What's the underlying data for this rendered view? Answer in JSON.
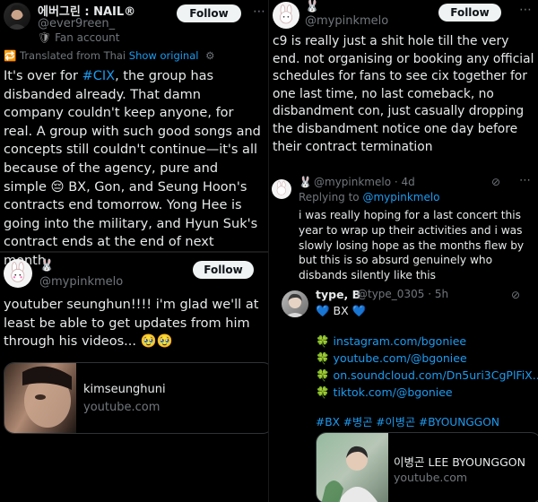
{
  "left": {
    "post1": {
      "display_name": "에버그린 : NAIL®",
      "handle": "@ever9reen_",
      "account_label": "Fan account",
      "follow_label": "Follow",
      "translated_label": "Translated from Thai",
      "show_original_label": "Show original",
      "text_before_tag": "It's over for ",
      "hashtag": "#CIX",
      "text_after_tag": ", the group has disbanded already. That damn company couldn't keep anyone, for real. A group with such good songs and concepts still couldn't continue—it's all because of the agency, pure and simple 😔 BX, Gon, and Seung Hoon's contracts end tomorrow. Yong Hee is going into the military, and Hyun Suk's contract ends at the end of next month."
    },
    "post2": {
      "display_name": "🐰",
      "handle": "@mypinkmelo",
      "follow_label": "Follow",
      "text": "youtuber seunghun!!!! i'm glad we'll at least be able to get updates from him through his videos... 🥹🥹",
      "card_title": "kimseunghuni",
      "card_domain": "youtube.com"
    }
  },
  "right": {
    "post1": {
      "display_name": "🐰",
      "handle": "@mypinkmelo",
      "follow_label": "Follow",
      "text": "c9 is really just a shit hole till the very end. not organising or booking any official schedules for fans to see cix together for one last time, no last comeback, no disbandment con, just casually dropping the disbandment notice one day before their contract termination"
    },
    "reply1": {
      "display_name": "🐰",
      "handle": "@mypinkmelo",
      "time": "· 4d",
      "replying_to_label": "Replying to ",
      "replying_to_handle": "@mypinkmelo",
      "text": "i was really hoping for a last concert this year to wrap up their activities and i was slowly losing hope as the months flew by but this is so absurd genuinely who disbands silently like this"
    },
    "reply2": {
      "display_name": "type, B",
      "handle": "@type_0305",
      "time": "· 5h",
      "bx_line": "💙 BX 💙",
      "links": [
        "instagram.com/bgoniee",
        "youtube.com/@bgoniee",
        "on.soundcloud.com/Dn5uri3CgPlFiX...",
        "tiktok.com/@bgoniee"
      ],
      "link_bullet": "🍀",
      "hashtags": "#BX #병곤 #이병곤 #BYOUNGGON",
      "card_title": "이병곤 LEE BYOUNGGON",
      "card_domain": "youtube.com"
    }
  },
  "colors": {
    "background": "#000000",
    "text": "#e7e9ea",
    "muted": "#71767b",
    "link": "#1d9bf0",
    "follow_bg": "#eff3f4"
  }
}
